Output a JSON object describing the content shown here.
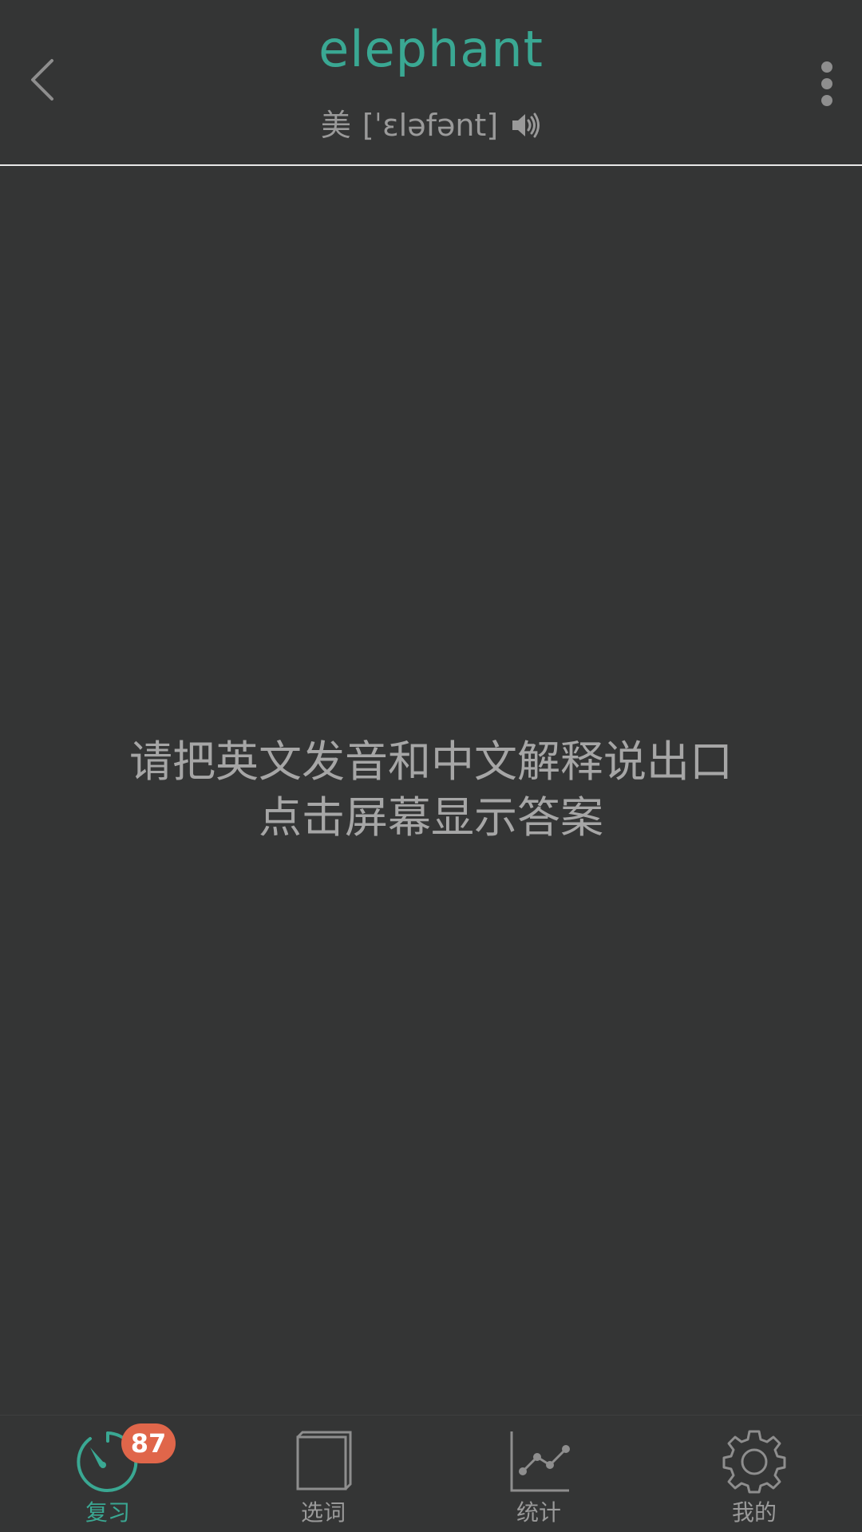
{
  "header": {
    "word": "elephant",
    "region": "美",
    "phonetic": "[ˈɛləfənt]",
    "back_icon": "chevron-left-icon",
    "menu_icon": "more-vertical-icon",
    "speaker_icon": "speaker-icon"
  },
  "main": {
    "prompt_line1": "请把英文发音和中文解释说出口",
    "prompt_line2": "点击屏幕显示答案"
  },
  "bottom_nav": {
    "items": [
      {
        "label": "复习",
        "icon": "review-dial-icon",
        "active": true,
        "badge": "87"
      },
      {
        "label": "选词",
        "icon": "book-icon",
        "active": false
      },
      {
        "label": "统计",
        "icon": "line-chart-icon",
        "active": false
      },
      {
        "label": "我的",
        "icon": "gear-icon",
        "active": false
      }
    ]
  },
  "colors": {
    "background": "#343535",
    "accent": "#3aa893",
    "text_muted": "#9a9a9a",
    "badge": "#e0664a",
    "divider": "#e8e8e8"
  }
}
